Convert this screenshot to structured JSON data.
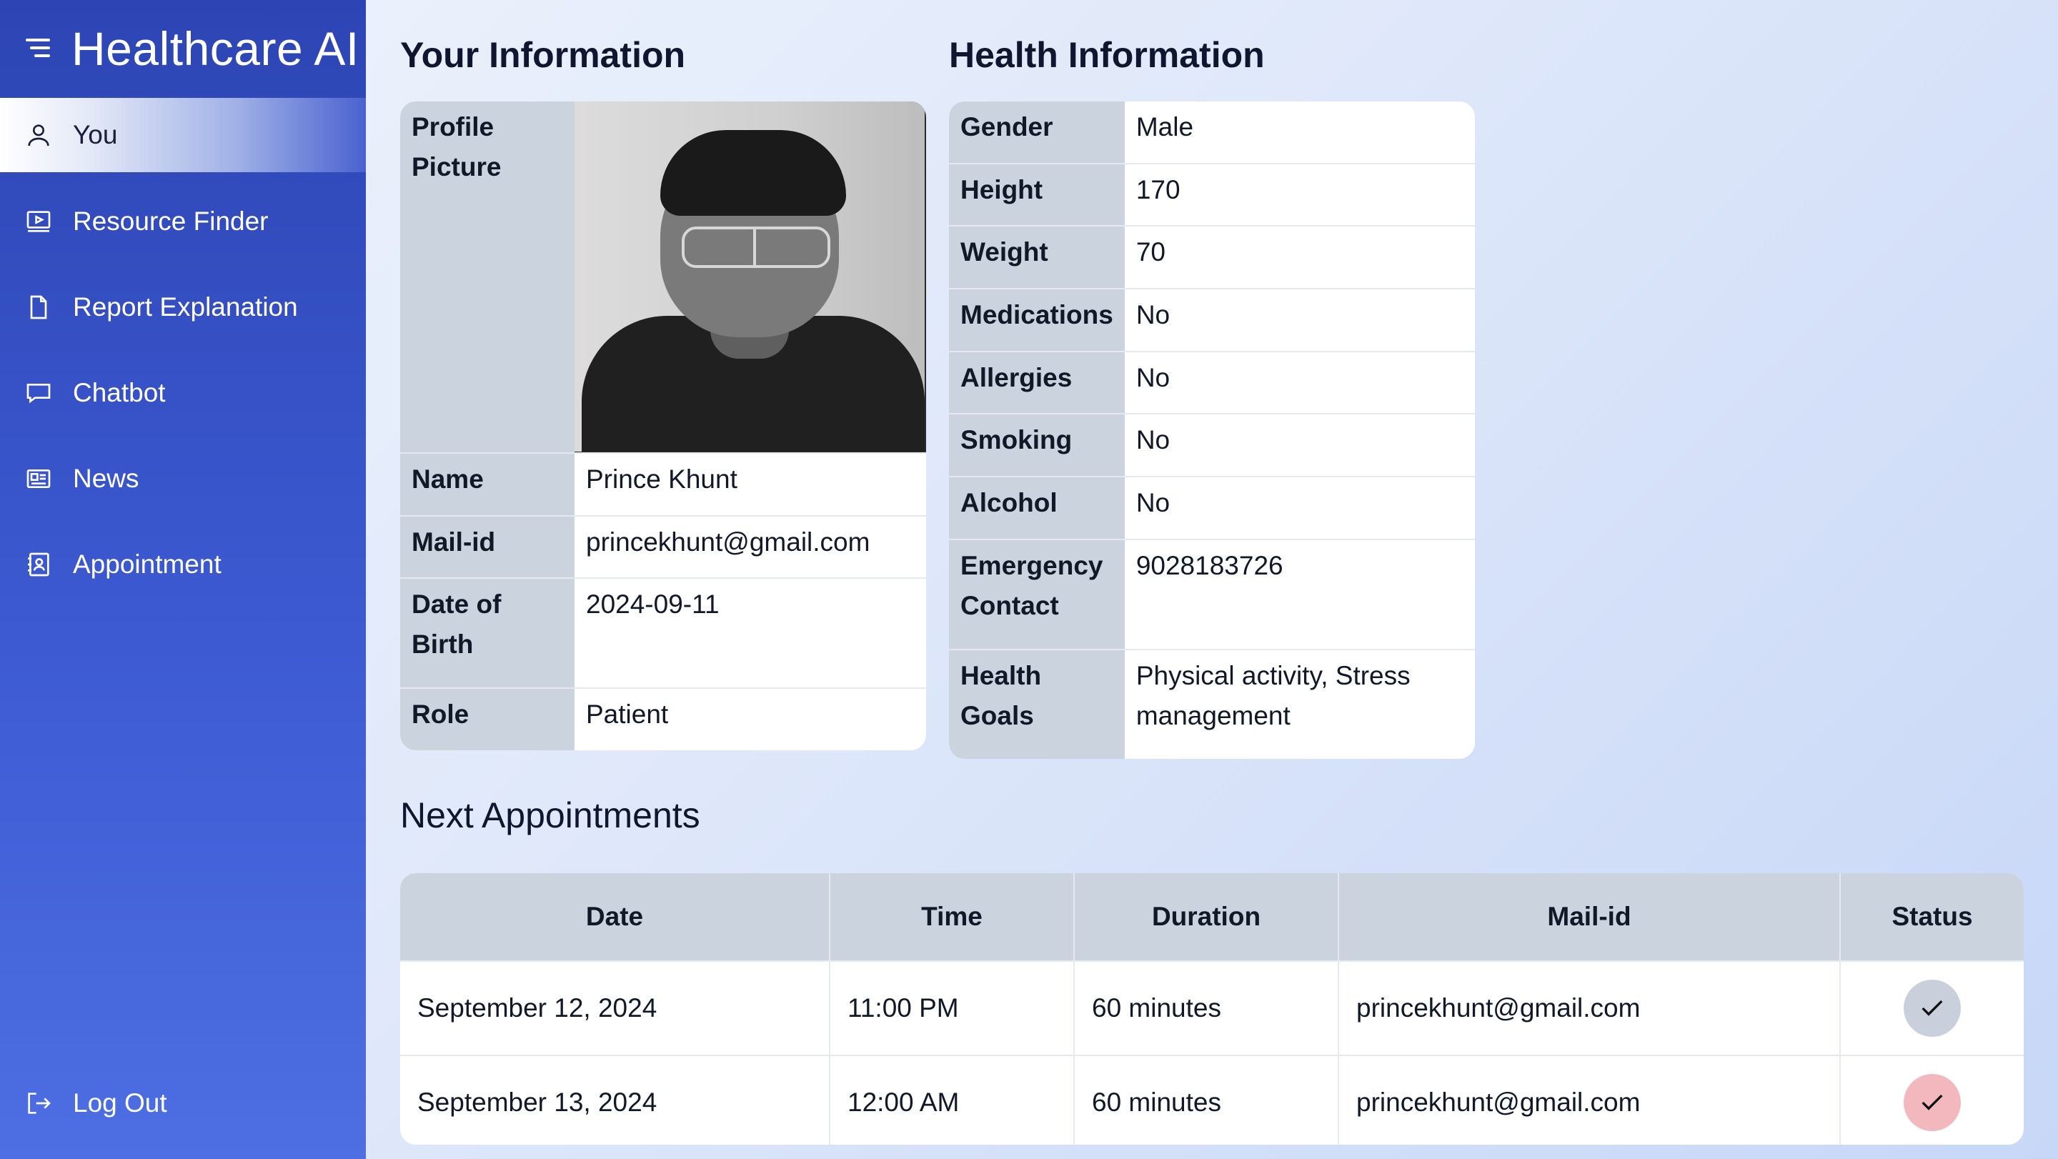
{
  "app": {
    "title": "Healthcare AI"
  },
  "sidebar": {
    "items": [
      {
        "label": "You",
        "icon": "user-icon"
      },
      {
        "label": "Resource Finder",
        "icon": "video-icon"
      },
      {
        "label": "Report Explanation",
        "icon": "document-icon"
      },
      {
        "label": "Chatbot",
        "icon": "chat-icon"
      },
      {
        "label": "News",
        "icon": "newspaper-icon"
      },
      {
        "label": "Appointment",
        "icon": "contact-book-icon"
      }
    ],
    "logout": {
      "label": "Log Out",
      "icon": "logout-icon"
    }
  },
  "your_info": {
    "heading": "Your Information",
    "rows": [
      {
        "key": "Profile Picture",
        "value": ""
      },
      {
        "key": "Name",
        "value": "Prince Khunt"
      },
      {
        "key": "Mail-id",
        "value": "princekhunt@gmail.com"
      },
      {
        "key": "Date of Birth",
        "value": "2024-09-11"
      },
      {
        "key": "Role",
        "value": "Patient"
      }
    ]
  },
  "health_info": {
    "heading": "Health Information",
    "rows": [
      {
        "key": "Gender",
        "value": "Male"
      },
      {
        "key": "Height",
        "value": "170"
      },
      {
        "key": "Weight",
        "value": "70"
      },
      {
        "key": "Medications",
        "value": "No"
      },
      {
        "key": "Allergies",
        "value": "No"
      },
      {
        "key": "Smoking",
        "value": "No"
      },
      {
        "key": "Alcohol",
        "value": "No"
      },
      {
        "key": "Emergency Contact",
        "value": "9028183726"
      },
      {
        "key": "Health Goals",
        "value": "Physical activity, Stress management"
      }
    ]
  },
  "appointments": {
    "heading": "Next Appointments",
    "columns": [
      "Date",
      "Time",
      "Duration",
      "Mail-id",
      "Status"
    ],
    "rows": [
      {
        "date": "September 12, 2024",
        "time": "11:00 PM",
        "duration": "60 minutes",
        "mail": "princekhunt@gmail.com",
        "status_color": "#c9d0db"
      },
      {
        "date": "September 13, 2024",
        "time": "12:00 AM",
        "duration": "60 minutes",
        "mail": "princekhunt@gmail.com",
        "status_color": "#f2b8be"
      }
    ]
  }
}
